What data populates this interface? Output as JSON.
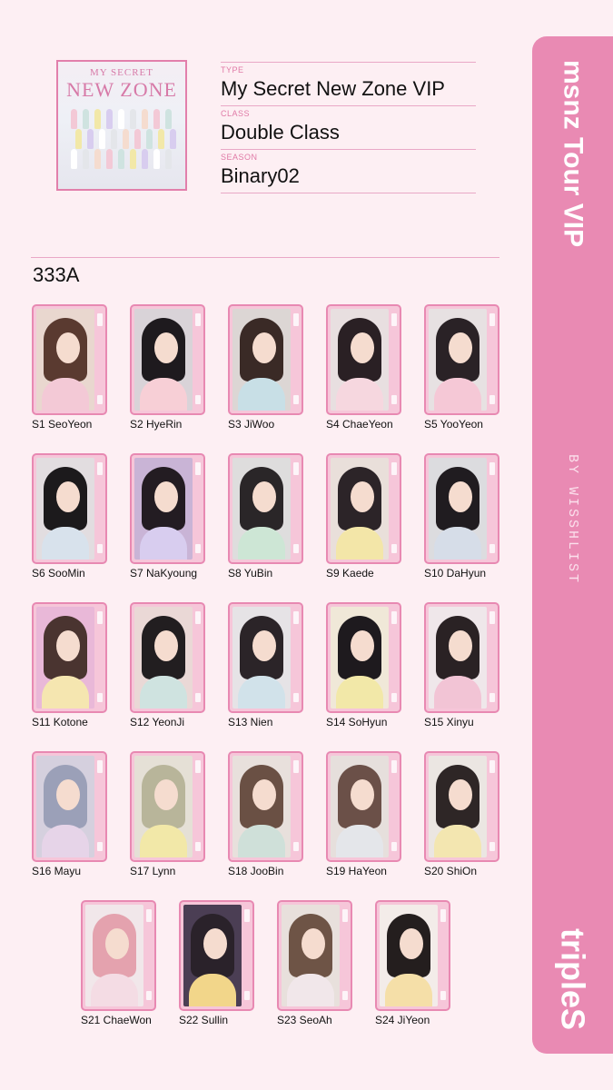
{
  "album": {
    "cover_line1": "MY SECRET",
    "cover_line2": "NEW ZONE"
  },
  "info": {
    "type_label": "TYPE",
    "type_value": "My Secret New Zone VIP",
    "class_label": "CLASS",
    "class_value": "Double Class",
    "season_label": "SEASON",
    "season_value": "Binary02"
  },
  "section": {
    "title": "333A"
  },
  "side": {
    "title": "msnz Tour VIP",
    "credit": "BY WISSHLIST",
    "brand": "tripleS"
  },
  "colors": {
    "accent": "#e98ab3",
    "background": "#fdeff3",
    "frame": "#e889b2"
  },
  "cards": [
    {
      "label": "S1 SeoYeon",
      "hair": "#5a3a30",
      "bg": "#e9d7cf",
      "top": "#f3c9d6"
    },
    {
      "label": "S2 HyeRin",
      "hair": "#1e1a1e",
      "bg": "#d9d3d8",
      "top": "#f7cfd6"
    },
    {
      "label": "S3 JiWoo",
      "hair": "#3a2a26",
      "bg": "#dcd6d4",
      "top": "#c8dfe6"
    },
    {
      "label": "S4 ChaeYeon",
      "hair": "#2a2024",
      "bg": "#e8dfe0",
      "top": "#f6d7df"
    },
    {
      "label": "S5 YooYeon",
      "hair": "#2a2226",
      "bg": "#e7e1e2",
      "top": "#f5c8d6"
    },
    {
      "label": "S6 SooMin",
      "hair": "#1c1a1c",
      "bg": "#e2dde0",
      "top": "#d8e2ec"
    },
    {
      "label": "S7 NaKyoung",
      "hair": "#231c22",
      "bg": "#c9b4d6",
      "top": "#d8cdef"
    },
    {
      "label": "S8 YuBin",
      "hair": "#2a2628",
      "bg": "#dedddd",
      "top": "#cde6d5"
    },
    {
      "label": "S9 Kaede",
      "hair": "#2c2428",
      "bg": "#e9dfda",
      "top": "#f3e6a8"
    },
    {
      "label": "S10 DaHyun",
      "hair": "#201c20",
      "bg": "#dcdcdf",
      "top": "#d6dde8"
    },
    {
      "label": "S11 Kotone",
      "hair": "#4a3430",
      "bg": "#e9b8d8",
      "top": "#f5e6b0"
    },
    {
      "label": "S12 YeonJi",
      "hair": "#221e20",
      "bg": "#ead8d6",
      "top": "#cfe3e0"
    },
    {
      "label": "S13 Nien",
      "hair": "#2b2428",
      "bg": "#e6e3e6",
      "top": "#d1e2ea"
    },
    {
      "label": "S14 SoHyun",
      "hair": "#1e1a1e",
      "bg": "#f0e8d8",
      "top": "#f2e8a8"
    },
    {
      "label": "S15 Xinyu",
      "hair": "#2a2224",
      "bg": "#efe7ea",
      "top": "#f2c4d5"
    },
    {
      "label": "S16 Mayu",
      "hair": "#9ba0b8",
      "bg": "#d5d0de",
      "top": "#e6d4e8"
    },
    {
      "label": "S17 Lynn",
      "hair": "#b8b59a",
      "bg": "#e5e0d6",
      "top": "#f2e8a8"
    },
    {
      "label": "S18 JooBin",
      "hair": "#6a5044",
      "bg": "#e8e0dc",
      "top": "#cfe0d9"
    },
    {
      "label": "S19 HaYeon",
      "hair": "#6b5048",
      "bg": "#e6dfdc",
      "top": "#e4e6ea"
    },
    {
      "label": "S20 ShiOn",
      "hair": "#2e2626",
      "bg": "#ebe6e2",
      "top": "#f3e6b0"
    },
    {
      "label": "S21 ChaeWon",
      "hair": "#e4a2ae",
      "bg": "#f1e7ea",
      "top": "#f4dce4"
    },
    {
      "label": "S22 Sullin",
      "hair": "#2a222a",
      "bg": "#4b3e54",
      "top": "#f2d68a"
    },
    {
      "label": "S23 SeoAh",
      "hair": "#6e5446",
      "bg": "#e8e0dc",
      "top": "#f1e7ea"
    },
    {
      "label": "S24 JiYeon",
      "hair": "#241e1e",
      "bg": "#f3ece9",
      "top": "#f5dfa8"
    }
  ]
}
